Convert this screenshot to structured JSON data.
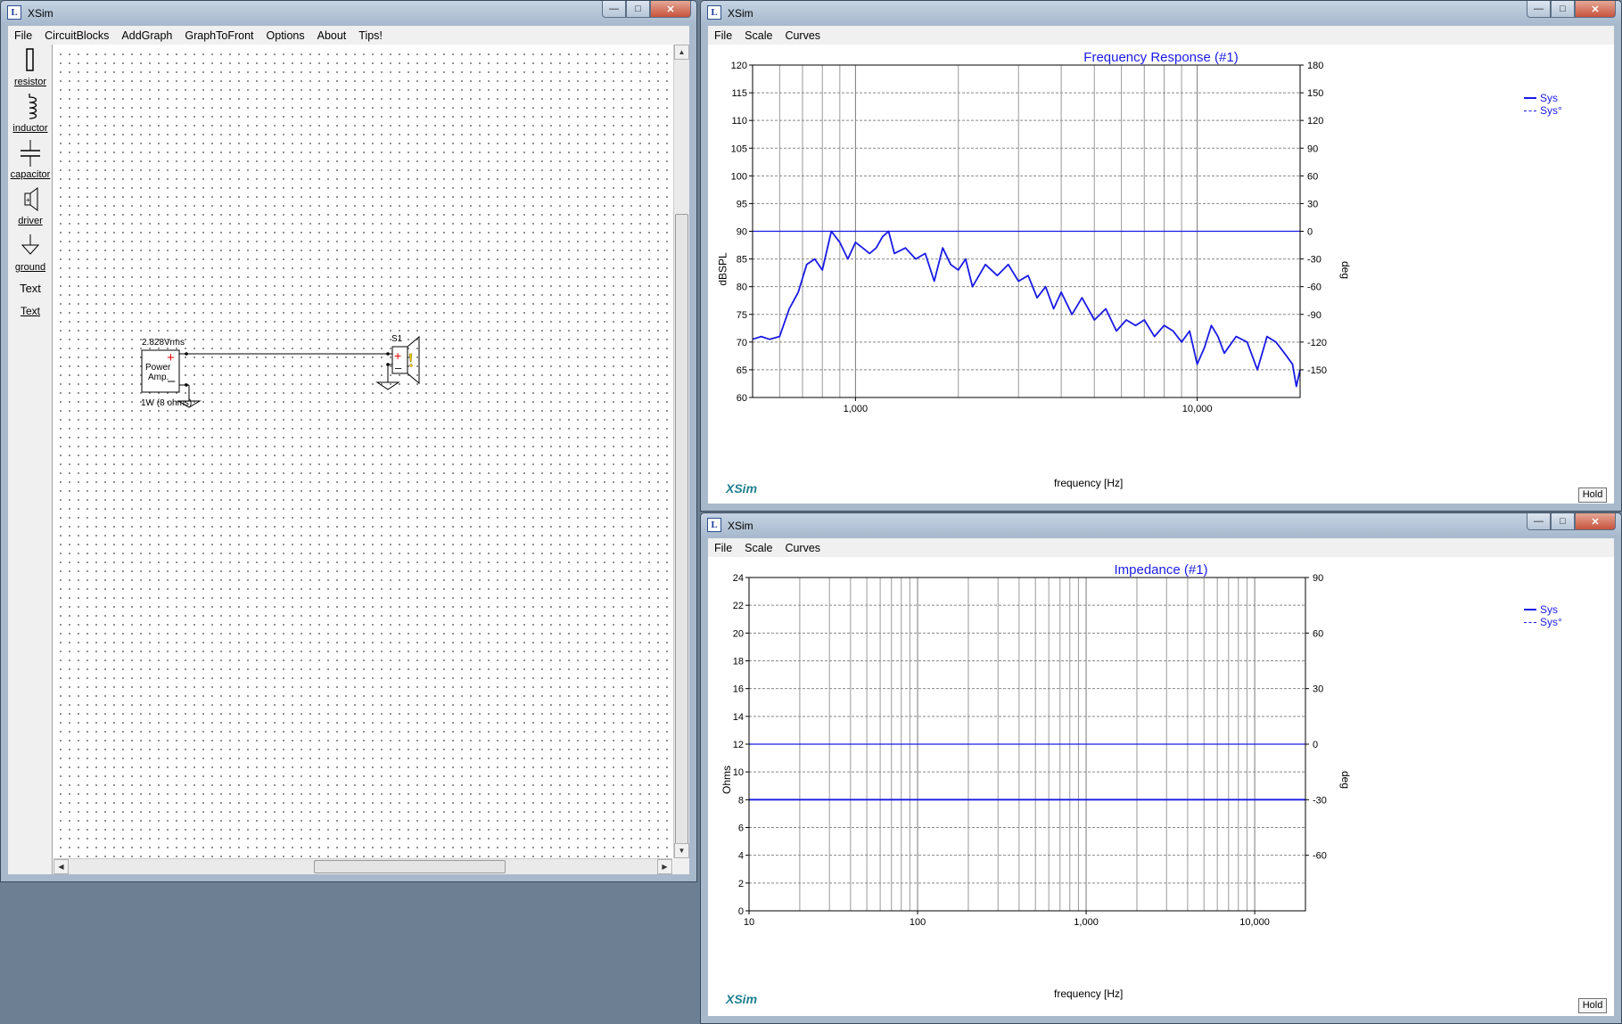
{
  "circuit_window": {
    "title": "XSim",
    "app_icon": "xsim-logo-icon",
    "menu": [
      "File",
      "CircuitBlocks",
      "AddGraph",
      "GraphToFront",
      "Options",
      "About",
      "Tips!"
    ],
    "palette": [
      {
        "label": "resistor",
        "icon": "resistor-icon"
      },
      {
        "label": "inductor",
        "icon": "inductor-icon"
      },
      {
        "label": "capacitor",
        "icon": "capacitor-icon"
      },
      {
        "label": "driver",
        "icon": "driver-icon"
      },
      {
        "label": "ground",
        "icon": "ground-icon"
      },
      {
        "label": "Text",
        "icon": "text-tool"
      },
      {
        "label": "Text",
        "icon": "text-link"
      }
    ],
    "circuit": {
      "amp_voltage": "2.828Vrms",
      "amp_label_1": "Power",
      "amp_label_2": "Amp.",
      "amp_rating": "1W (8 ohms)",
      "speaker_label": "S1"
    }
  },
  "frequency_window": {
    "title": "XSim",
    "menu": [
      "File",
      "Scale",
      "Curves"
    ],
    "hold_label": "Hold",
    "brand": "XSim",
    "chart_data": {
      "type": "line",
      "title": "Frequency Response (#1)",
      "xlabel": "frequency [Hz]",
      "ylabel": "dBSPL",
      "y2label": "deg",
      "xscale": "log",
      "xlim": [
        500,
        20000
      ],
      "ylim": [
        60,
        120
      ],
      "y2lim": [
        -180,
        180
      ],
      "x_tick_labels": [
        "1,000",
        "10,000"
      ],
      "y_ticks": [
        60,
        65,
        70,
        75,
        80,
        85,
        90,
        95,
        100,
        105,
        110,
        115,
        120
      ],
      "y2_ticks": [
        -150,
        -120,
        -90,
        -60,
        -30,
        0,
        30,
        60,
        90,
        120,
        150,
        180
      ],
      "grid": true,
      "legend_position": "right",
      "series": [
        {
          "name": "Sys",
          "style": "solid",
          "color": "#1a1ae6",
          "x": [
            500,
            530,
            560,
            600,
            640,
            680,
            720,
            760,
            800,
            850,
            900,
            950,
            1000,
            1050,
            1100,
            1150,
            1200,
            1250,
            1300,
            1400,
            1500,
            1600,
            1700,
            1800,
            1900,
            2000,
            2100,
            2200,
            2400,
            2600,
            2800,
            3000,
            3200,
            3400,
            3600,
            3800,
            4000,
            4300,
            4600,
            5000,
            5400,
            5800,
            6200,
            6600,
            7000,
            7500,
            8000,
            8500,
            9000,
            9500,
            10000,
            10500,
            11000,
            11500,
            12000,
            13000,
            14000,
            15000,
            16000,
            17000,
            18000,
            19000,
            19500,
            20000
          ],
          "y": [
            70.5,
            71,
            70.5,
            71,
            76,
            79,
            84,
            85,
            83,
            90,
            88,
            85,
            88,
            87,
            86,
            87,
            89,
            90,
            86,
            87,
            85,
            86,
            81,
            87,
            84,
            83,
            85,
            80,
            84,
            82,
            84,
            81,
            82,
            78,
            80,
            76,
            79,
            75,
            78,
            74,
            76,
            72,
            74,
            73,
            74,
            71,
            73,
            72,
            70,
            72,
            66,
            69,
            73,
            71,
            68,
            71,
            70,
            65,
            71,
            70,
            68,
            66,
            62,
            65
          ]
        },
        {
          "name": "Sys°",
          "style": "dashed",
          "color": "#1a1ae6",
          "x": [
            500,
            20000
          ],
          "y": [
            90,
            90
          ]
        }
      ]
    }
  },
  "impedance_window": {
    "title": "XSim",
    "menu": [
      "File",
      "Scale",
      "Curves"
    ],
    "hold_label": "Hold",
    "brand": "XSim",
    "chart_data": {
      "type": "line",
      "title": "Impedance (#1)",
      "xlabel": "frequency [Hz]",
      "ylabel": "Ohms",
      "y2label": "deg",
      "xscale": "log",
      "xlim": [
        10,
        20000
      ],
      "ylim": [
        0,
        24
      ],
      "y2lim": [
        -90,
        90
      ],
      "x_tick_labels": [
        "10",
        "100",
        "1,000",
        "10,000"
      ],
      "y_ticks": [
        0,
        2,
        4,
        6,
        8,
        10,
        12,
        14,
        16,
        18,
        20,
        22,
        24
      ],
      "y2_ticks": [
        -60,
        -30,
        0,
        30,
        60,
        90
      ],
      "grid": true,
      "legend_position": "right",
      "series": [
        {
          "name": "Sys",
          "style": "solid",
          "color": "#1a1ae6",
          "x": [
            10,
            20000
          ],
          "y": [
            8,
            8
          ]
        },
        {
          "name": "Sys°",
          "style": "dashed",
          "color": "#1a1ae6",
          "x": [
            10,
            20000
          ],
          "y": [
            12,
            12
          ]
        }
      ]
    }
  }
}
